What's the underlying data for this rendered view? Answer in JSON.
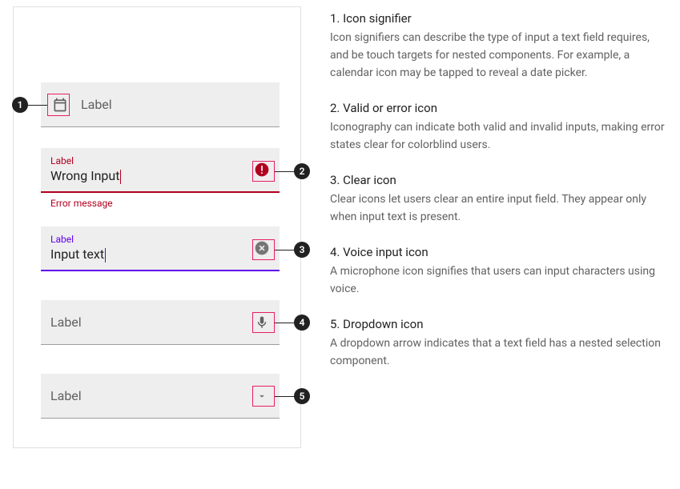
{
  "fields": {
    "f1": {
      "label": "Label"
    },
    "f2": {
      "label": "Label",
      "value": "Wrong Input",
      "helper": "Error message"
    },
    "f3": {
      "label": "Label",
      "value": "Input text"
    },
    "f4": {
      "label": "Label"
    },
    "f5": {
      "label": "Label"
    }
  },
  "callouts": {
    "c1": {
      "num": "1",
      "title": "1. Icon signifier",
      "body": "Icon signifiers can describe the type of input a text field requires, and be touch targets for nested components. For example, a calendar icon may be tapped to reveal a date picker."
    },
    "c2": {
      "num": "2",
      "title": "2. Valid or error icon",
      "body": "Iconography can indicate both valid and invalid inputs, making error states clear for colorblind users."
    },
    "c3": {
      "num": "3",
      "title": "3. Clear icon",
      "body": "Clear icons let users clear an entire input field. They appear only when input text is present."
    },
    "c4": {
      "num": "4",
      "title": "4. Voice input icon",
      "body": "A microphone icon signifies that users can input characters using voice."
    },
    "c5": {
      "num": "5",
      "title": "5. Dropdown icon",
      "body": "A dropdown arrow indicates that a text field has a nested selection component."
    }
  }
}
